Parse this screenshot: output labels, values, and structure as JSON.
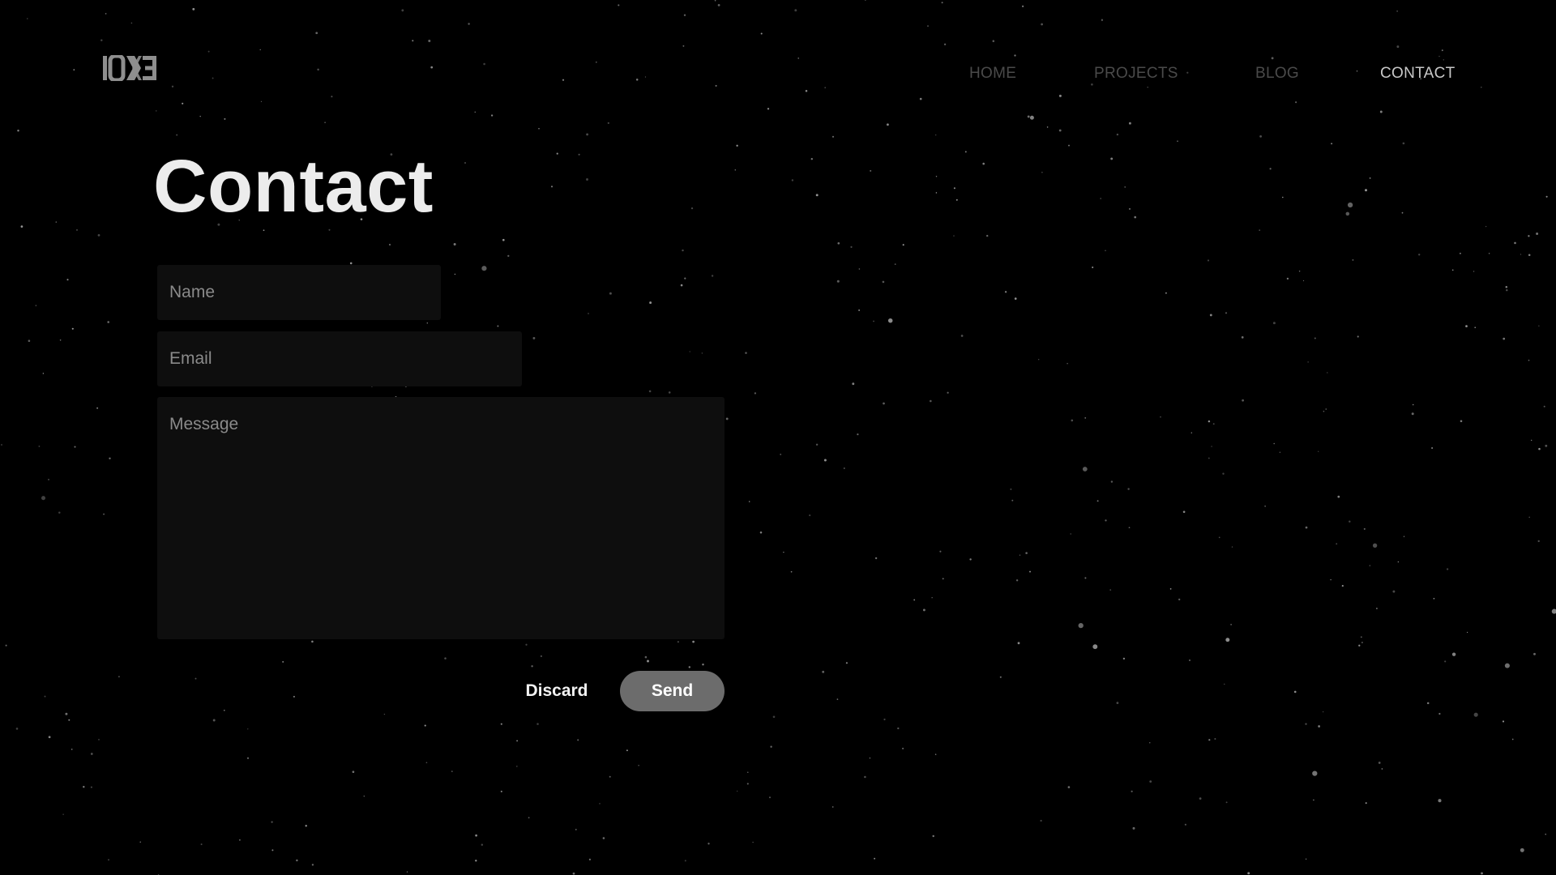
{
  "header": {
    "logo_text": "IOXE",
    "nav": [
      {
        "label": "HOME",
        "active": false
      },
      {
        "label": "PROJECTS",
        "active": false
      },
      {
        "label": "BLOG",
        "active": false
      },
      {
        "label": "CONTACT",
        "active": true
      }
    ]
  },
  "main": {
    "title": "Contact",
    "form": {
      "name_placeholder": "Name",
      "name_value": "",
      "email_placeholder": "Email",
      "email_value": "",
      "message_placeholder": "Message",
      "message_value": "",
      "discard_label": "Discard",
      "send_label": "Send"
    }
  },
  "colors": {
    "background": "#000000",
    "field_background": "#0e0e0e",
    "send_button": "#6c6c6c",
    "nav_inactive": "#4a4a4a",
    "nav_active": "#c8c8c8"
  },
  "icons": {
    "logo": "ioxe-logo-icon"
  }
}
